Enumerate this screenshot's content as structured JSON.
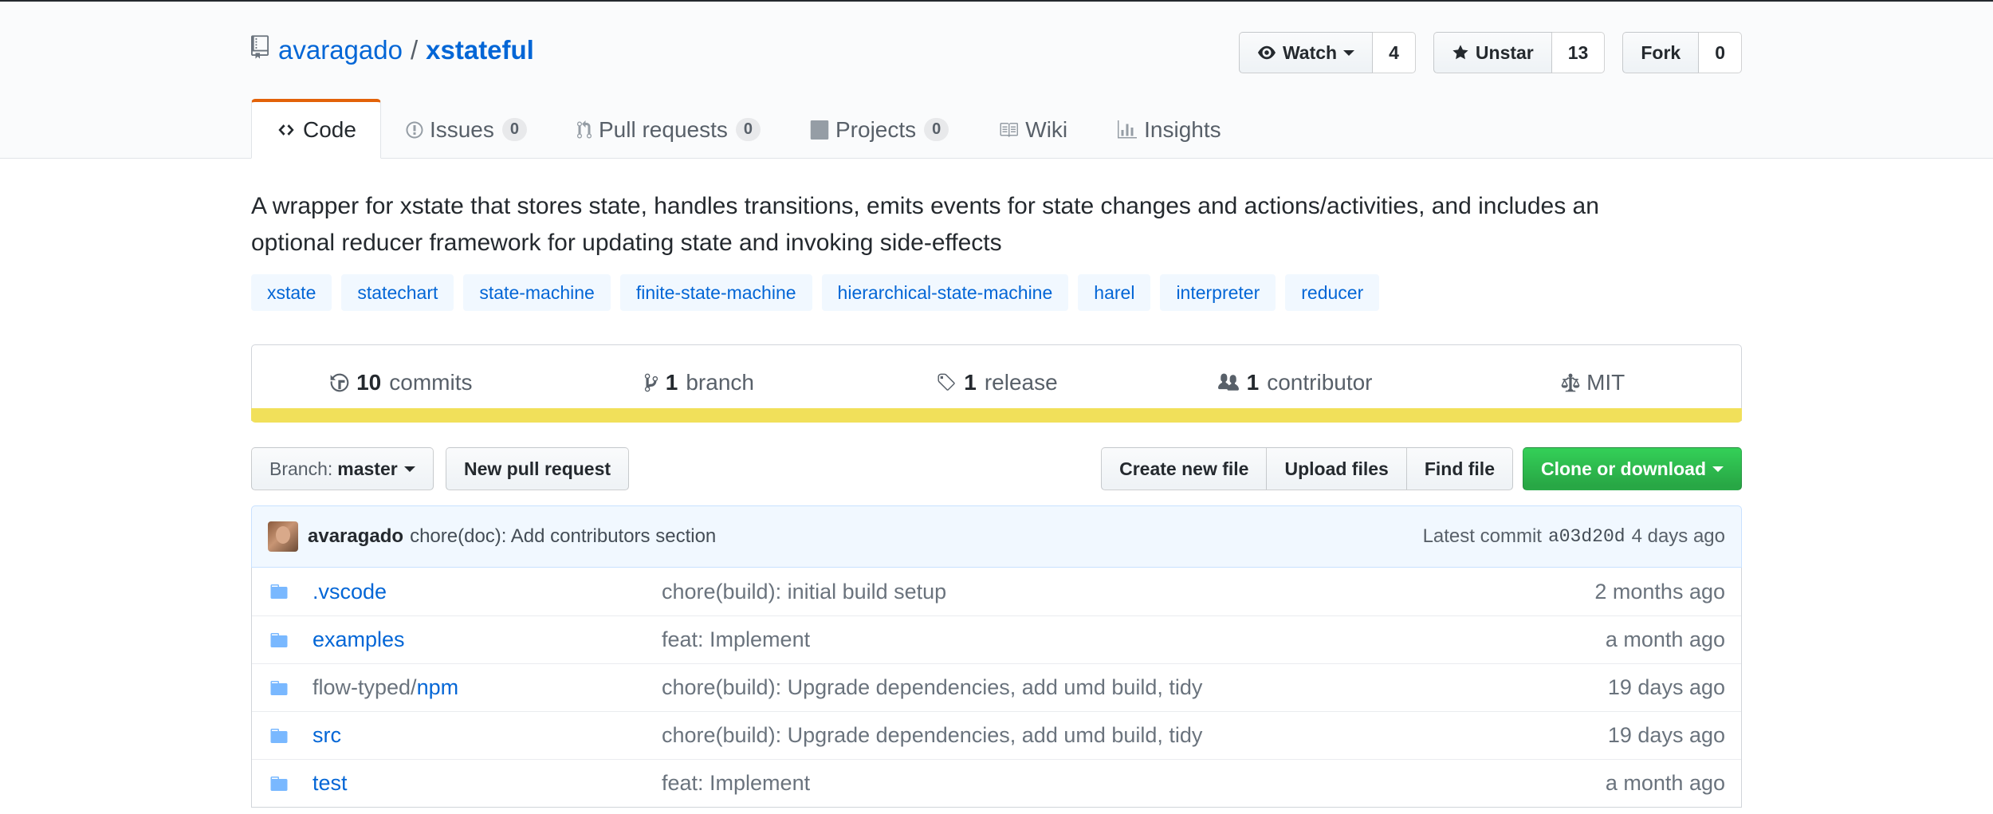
{
  "repo": {
    "owner": "avaragado",
    "separator": "/",
    "name": "xstateful"
  },
  "actions": {
    "watch_label": "Watch",
    "watch_count": "4",
    "star_label": "Unstar",
    "star_count": "13",
    "fork_label": "Fork",
    "fork_count": "0"
  },
  "tabs": [
    {
      "label": "Code",
      "icon": "code-icon"
    },
    {
      "label": "Issues",
      "count": "0",
      "icon": "issue-icon"
    },
    {
      "label": "Pull requests",
      "count": "0",
      "icon": "pull-request-icon"
    },
    {
      "label": "Projects",
      "count": "0",
      "icon": "project-icon"
    },
    {
      "label": "Wiki",
      "icon": "book-icon"
    },
    {
      "label": "Insights",
      "icon": "graph-icon"
    }
  ],
  "description": "A wrapper for xstate that stores state, handles transitions, emits events for state changes and actions/activities, and includes an optional reducer framework for updating state and invoking side-effects",
  "topics": [
    "xstate",
    "statechart",
    "state-machine",
    "finite-state-machine",
    "hierarchical-state-machine",
    "harel",
    "interpreter",
    "reducer"
  ],
  "summary": {
    "commits_num": "10",
    "commits_label": "commits",
    "branch_num": "1",
    "branch_label": "branch",
    "release_num": "1",
    "release_label": "release",
    "contributor_num": "1",
    "contributor_label": "contributor",
    "license": "MIT"
  },
  "language_color": "#f1e05a",
  "filebar": {
    "branch_prefix": "Branch:",
    "branch_name": "master",
    "new_pr": "New pull request",
    "create_file": "Create new file",
    "upload_files": "Upload files",
    "find_file": "Find file",
    "clone": "Clone or download"
  },
  "latest_commit": {
    "author": "avaragado",
    "message": "chore(doc): Add contributors section",
    "label": "Latest commit",
    "sha": "a03d20d",
    "age": "4 days ago"
  },
  "files": [
    {
      "prefix": "",
      "name": ".vscode",
      "message": "chore(build): initial build setup",
      "age": "2 months ago"
    },
    {
      "prefix": "",
      "name": "examples",
      "message": "feat: Implement",
      "age": "a month ago"
    },
    {
      "prefix": "flow-typed/",
      "name": "npm",
      "message": "chore(build): Upgrade dependencies, add umd build, tidy",
      "age": "19 days ago"
    },
    {
      "prefix": "",
      "name": "src",
      "message": "chore(build): Upgrade dependencies, add umd build, tidy",
      "age": "19 days ago"
    },
    {
      "prefix": "",
      "name": "test",
      "message": "feat: Implement",
      "age": "a month ago"
    }
  ]
}
